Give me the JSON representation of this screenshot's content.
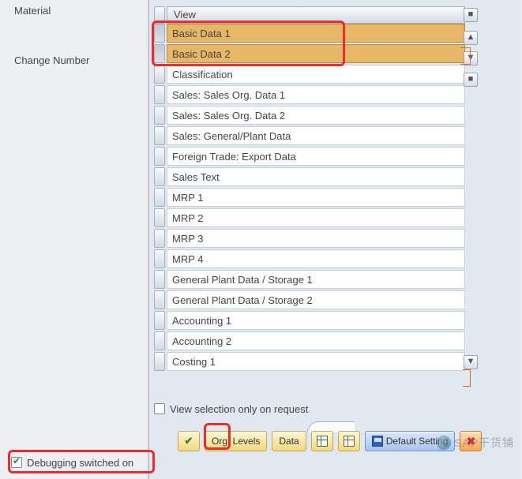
{
  "left_fields": {
    "material_label": "Material",
    "change_number_label": "Change Number"
  },
  "grid": {
    "header": "View",
    "rows": [
      {
        "text": "Basic Data 1",
        "selected": true
      },
      {
        "text": "Basic Data 2",
        "selected": true
      },
      {
        "text": "Classification",
        "selected": false
      },
      {
        "text": "Sales: Sales Org. Data 1",
        "selected": false
      },
      {
        "text": "Sales: Sales Org. Data 2",
        "selected": false
      },
      {
        "text": "Sales: General/Plant Data",
        "selected": false
      },
      {
        "text": "Foreign Trade: Export Data",
        "selected": false
      },
      {
        "text": "Sales Text",
        "selected": false
      },
      {
        "text": "MRP 1",
        "selected": false
      },
      {
        "text": "MRP 2",
        "selected": false
      },
      {
        "text": "MRP 3",
        "selected": false
      },
      {
        "text": "MRP 4",
        "selected": false
      },
      {
        "text": "General Plant Data / Storage 1",
        "selected": false
      },
      {
        "text": "General Plant Data / Storage 2",
        "selected": false
      },
      {
        "text": "Accounting 1",
        "selected": false
      },
      {
        "text": "Accounting 2",
        "selected": false
      },
      {
        "text": "Costing 1",
        "selected": false
      }
    ]
  },
  "checkbox": {
    "label": "View selection only on request",
    "checked": false
  },
  "toolbar": {
    "continue": "",
    "org_levels": "Org. Levels",
    "data": "Data",
    "default_setting": "Default Setting"
  },
  "status": {
    "debug_text": "Debugging switched on"
  },
  "watermark": {
    "text": "SAP干货铺"
  }
}
